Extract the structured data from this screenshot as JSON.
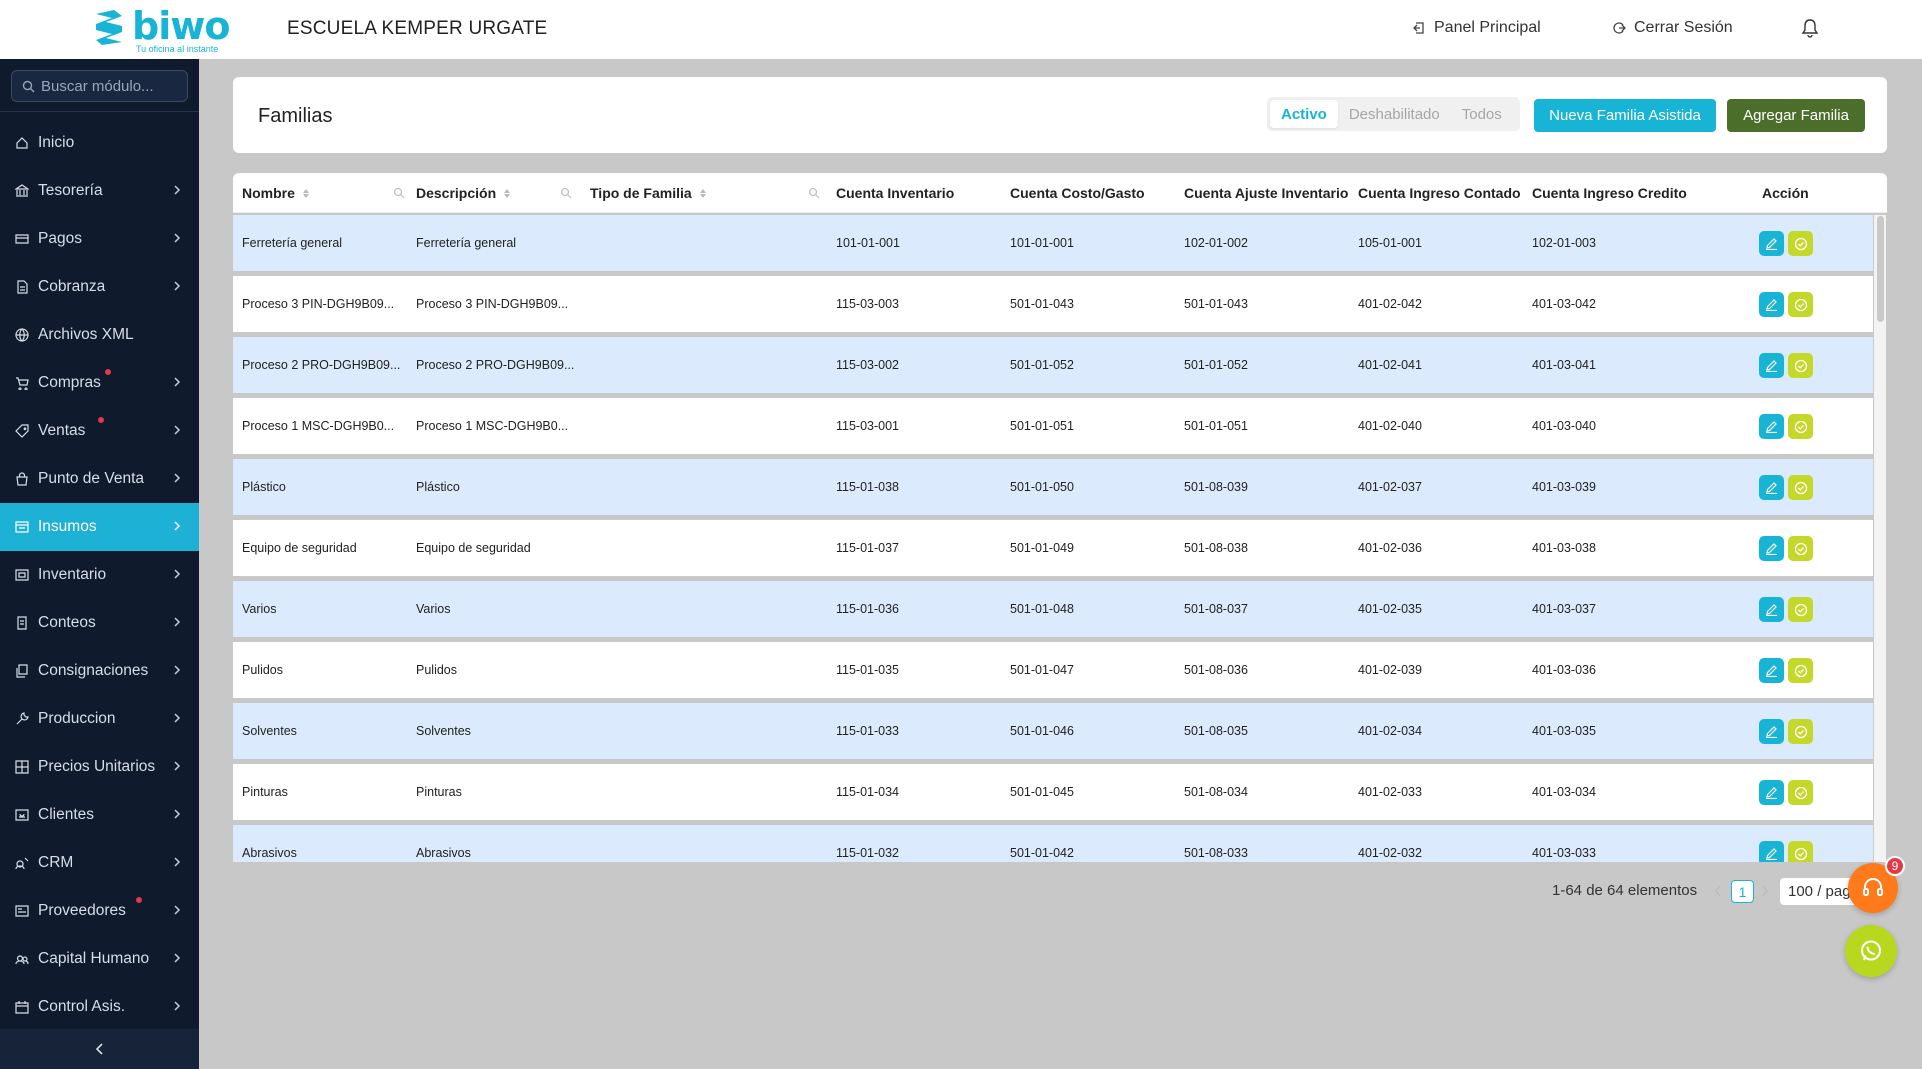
{
  "brand": {
    "name": "biwo",
    "tagline": "Tu oficina al instante",
    "color": "#17b4d6"
  },
  "header": {
    "school": "ESCUELA KEMPER URGATE",
    "panel_label": "Panel Principal",
    "logout_label": "Cerrar Sesión"
  },
  "sidebar": {
    "search_placeholder": "Buscar módulo...",
    "items": [
      {
        "label": "Inicio",
        "icon": "home-icon",
        "chevron": false,
        "dot": false,
        "active": false
      },
      {
        "label": "Tesorería",
        "icon": "bank-icon",
        "chevron": true,
        "dot": false,
        "active": false
      },
      {
        "label": "Pagos",
        "icon": "payment-icon",
        "chevron": true,
        "dot": false,
        "active": false
      },
      {
        "label": "Cobranza",
        "icon": "document-icon",
        "chevron": true,
        "dot": false,
        "active": false
      },
      {
        "label": "Archivos XML",
        "icon": "xml-icon",
        "chevron": false,
        "dot": false,
        "active": false
      },
      {
        "label": "Compras",
        "icon": "cart-icon",
        "chevron": true,
        "dot": true,
        "active": false
      },
      {
        "label": "Ventas",
        "icon": "tag-icon",
        "chevron": true,
        "dot": true,
        "active": false
      },
      {
        "label": "Punto de Venta",
        "icon": "bag-icon",
        "chevron": true,
        "dot": false,
        "active": false
      },
      {
        "label": "Insumos",
        "icon": "box-icon",
        "chevron": true,
        "dot": false,
        "active": true
      },
      {
        "label": "Inventario",
        "icon": "inventory-icon",
        "chevron": true,
        "dot": false,
        "active": false
      },
      {
        "label": "Conteos",
        "icon": "count-icon",
        "chevron": true,
        "dot": false,
        "active": false
      },
      {
        "label": "Consignaciones",
        "icon": "copy-icon",
        "chevron": true,
        "dot": false,
        "active": false
      },
      {
        "label": "Produccion",
        "icon": "wrench-icon",
        "chevron": true,
        "dot": false,
        "active": false
      },
      {
        "label": "Precios Unitarios",
        "icon": "grid-icon",
        "chevron": true,
        "dot": false,
        "active": false
      },
      {
        "label": "Clientes",
        "icon": "client-icon",
        "chevron": true,
        "dot": false,
        "active": false
      },
      {
        "label": "CRM",
        "icon": "crm-icon",
        "chevron": true,
        "dot": false,
        "active": false
      },
      {
        "label": "Proveedores",
        "icon": "supplier-icon",
        "chevron": true,
        "dot": true,
        "active": false
      },
      {
        "label": "Capital Humano",
        "icon": "people-icon",
        "chevron": true,
        "dot": false,
        "active": false
      },
      {
        "label": "Control Asis.",
        "icon": "calendar-icon",
        "chevron": true,
        "dot": false,
        "active": false
      }
    ]
  },
  "page": {
    "title": "Familias",
    "filters": [
      "Activo",
      "Deshabilitado",
      "Todos"
    ],
    "active_filter": "Activo",
    "btn_assisted": "Nueva Familia Asistida",
    "btn_add": "Agregar Familia"
  },
  "table": {
    "columns": [
      "Nombre",
      "Descripción",
      "Tipo de Familia",
      "Cuenta Inventario",
      "Cuenta Costo/Gasto",
      "Cuenta Ajuste Inventario",
      "Cuenta Ingreso Contado",
      "Cuenta Ingreso Credito",
      "Acción"
    ],
    "rows": [
      [
        "Ferretería general",
        "Ferretería general",
        "",
        "101-01-001",
        "101-01-001",
        "102-01-002",
        "105-01-001",
        "102-01-003"
      ],
      [
        "Proceso 3 PIN-DGH9B09...",
        "Proceso 3 PIN-DGH9B09...",
        "",
        "115-03-003",
        "501-01-043",
        "501-01-043",
        "401-02-042",
        "401-03-042"
      ],
      [
        "Proceso 2 PRO-DGH9B09...",
        "Proceso 2 PRO-DGH9B09...",
        "",
        "115-03-002",
        "501-01-052",
        "501-01-052",
        "401-02-041",
        "401-03-041"
      ],
      [
        "Proceso 1 MSC-DGH9B0...",
        "Proceso 1 MSC-DGH9B0...",
        "",
        "115-03-001",
        "501-01-051",
        "501-01-051",
        "401-02-040",
        "401-03-040"
      ],
      [
        "Plástico",
        "Plástico",
        "",
        "115-01-038",
        "501-01-050",
        "501-08-039",
        "401-02-037",
        "401-03-039"
      ],
      [
        "Equipo de seguridad",
        "Equipo de seguridad",
        "",
        "115-01-037",
        "501-01-049",
        "501-08-038",
        "401-02-036",
        "401-03-038"
      ],
      [
        "Varios",
        "Varios",
        "",
        "115-01-036",
        "501-01-048",
        "501-08-037",
        "401-02-035",
        "401-03-037"
      ],
      [
        "Pulidos",
        "Pulidos",
        "",
        "115-01-035",
        "501-01-047",
        "501-08-036",
        "401-02-039",
        "401-03-036"
      ],
      [
        "Solventes",
        "Solventes",
        "",
        "115-01-033",
        "501-01-046",
        "501-08-035",
        "401-02-034",
        "401-03-035"
      ],
      [
        "Pinturas",
        "Pinturas",
        "",
        "115-01-034",
        "501-01-045",
        "501-08-034",
        "401-02-033",
        "401-03-034"
      ],
      [
        "Abrasivos",
        "Abrasivos",
        "",
        "115-01-032",
        "501-01-042",
        "501-08-033",
        "401-02-032",
        "401-03-033"
      ]
    ]
  },
  "pagination": {
    "total_label": "1-64 de 64 elementos",
    "current_page": "1",
    "page_size": "100 / pag"
  },
  "support": {
    "badge": "9"
  },
  "colors": {
    "accent": "#17b4d6",
    "olive": "#4b6f2a",
    "lime": "#c4d82a",
    "sidebar_bg": "#0f1b2d",
    "row_blue": "#dbeafc"
  }
}
